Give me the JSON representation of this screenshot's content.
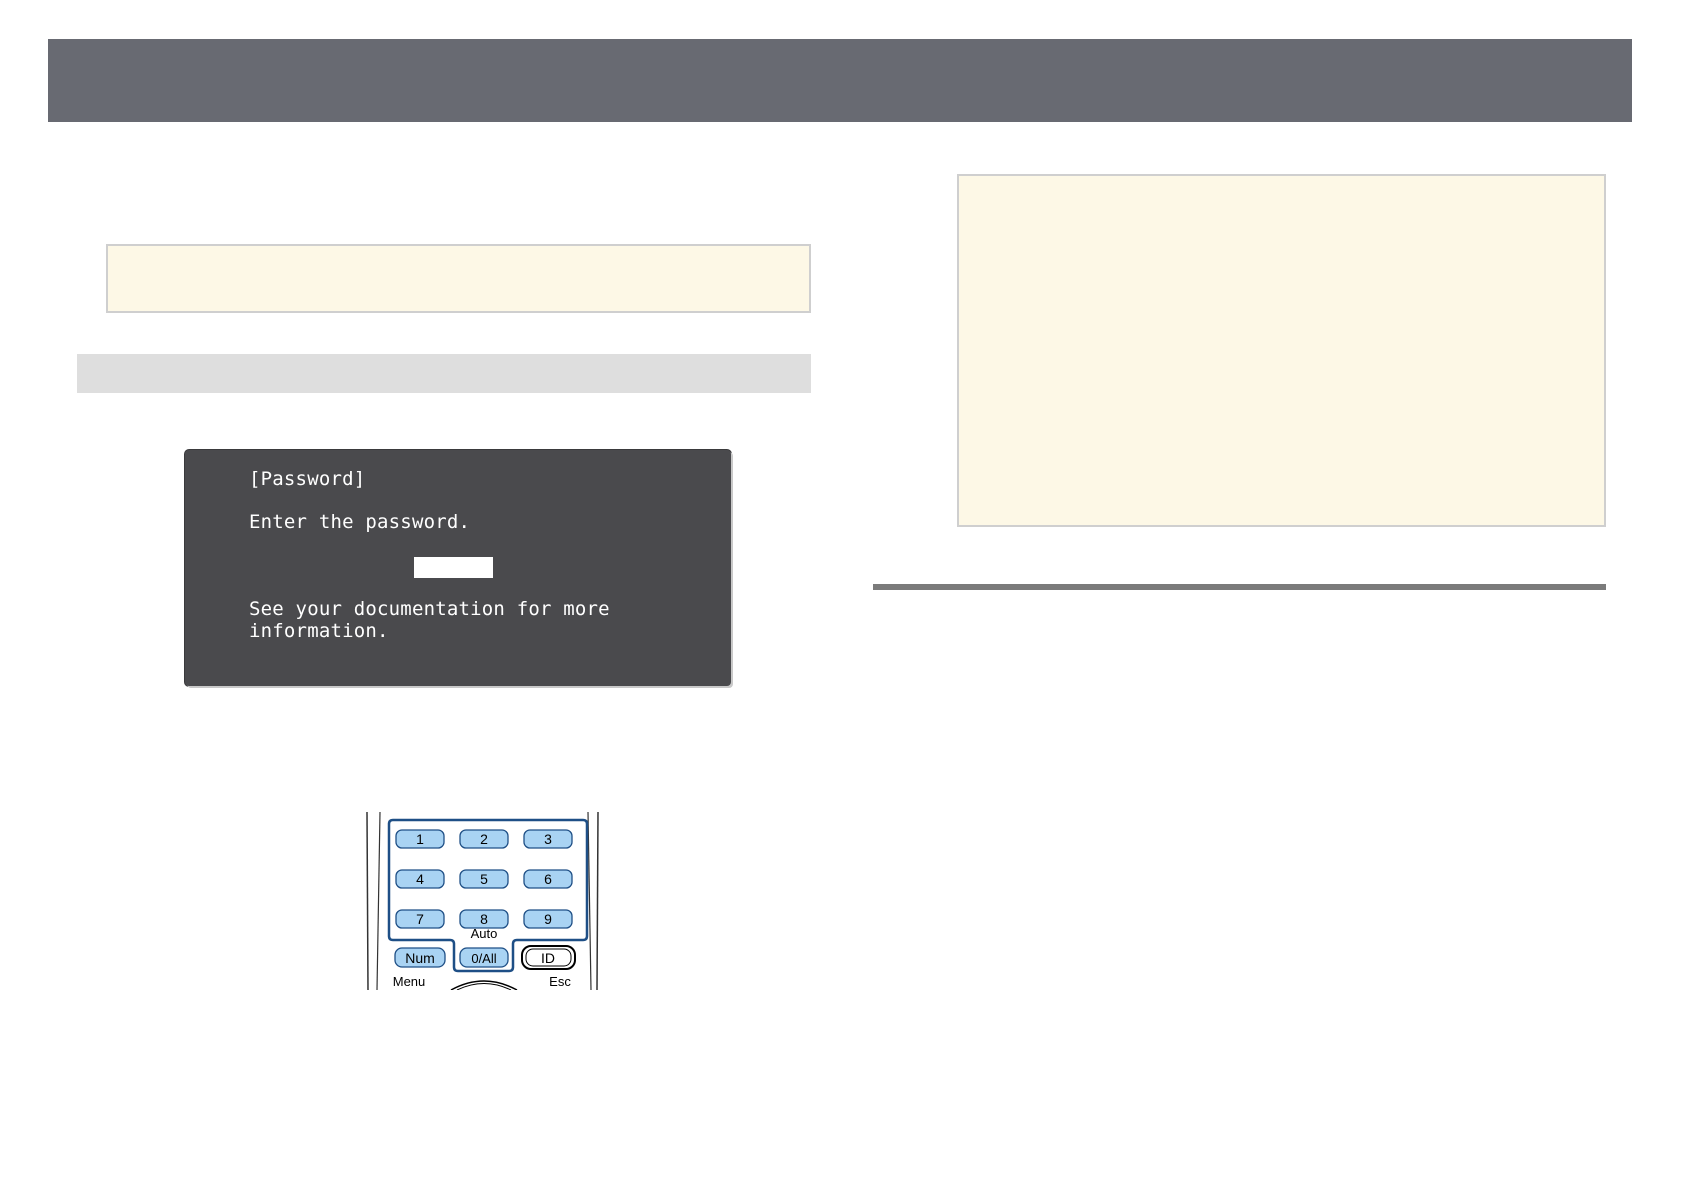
{
  "osd": {
    "title": "[Password]",
    "prompt": "Enter the password.",
    "info": "See your documentation for more information."
  },
  "remote": {
    "keys": [
      "1",
      "2",
      "3",
      "4",
      "5",
      "6",
      "7",
      "8",
      "9"
    ],
    "num_label": "Num",
    "zero_label": "0/All",
    "id_label": "ID",
    "auto_label": "Auto",
    "menu_label": "Menu",
    "esc_label": "Esc"
  },
  "colors": {
    "header": "#686a72",
    "note_background": "#fdf8e6",
    "key_fill": "#a9d3f3",
    "highlight_outline": "#1e4f86"
  }
}
